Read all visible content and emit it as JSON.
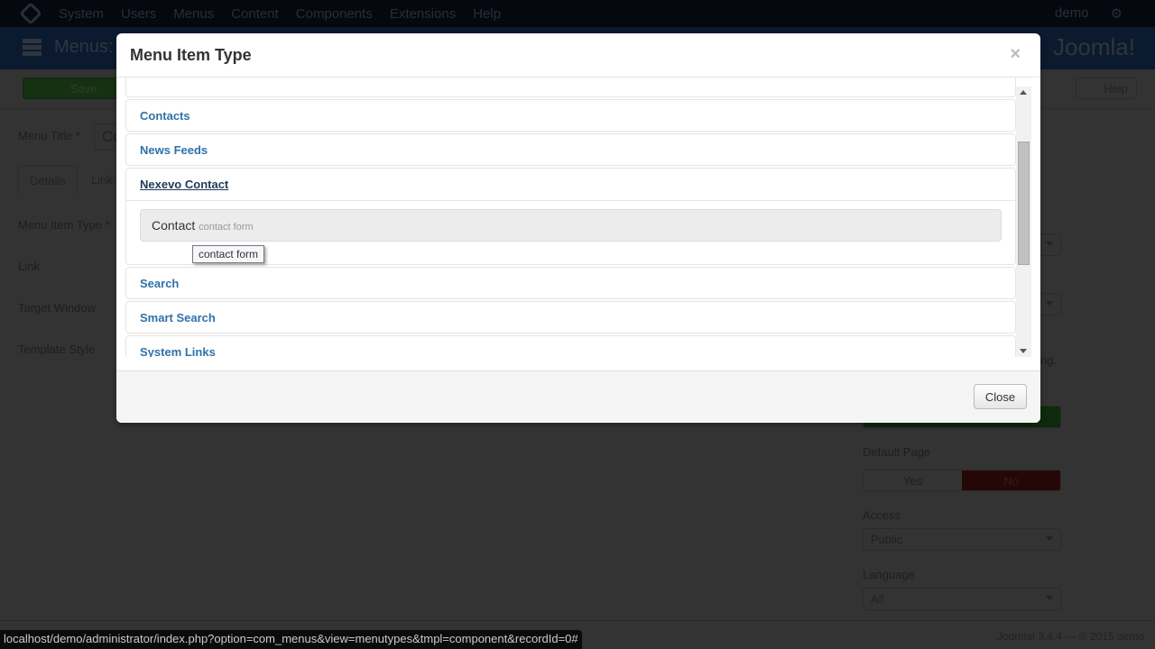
{
  "topnav": {
    "items": [
      "System",
      "Users",
      "Menus",
      "Content",
      "Components",
      "Extensions",
      "Help"
    ],
    "user": "demo"
  },
  "header": {
    "title": "Menus:",
    "brand": "Joomla!"
  },
  "toolbar": {
    "save": "Save",
    "help": "Help"
  },
  "form": {
    "menu_title_label": "Menu Title *",
    "menu_title_value": "Co",
    "tabs": [
      "Details",
      "Link"
    ],
    "fields": [
      "Menu Item Type *",
      "Link",
      "Target Window",
      "Template Style"
    ]
  },
  "side": {
    "partial_text": "ing.",
    "default_page_label": "Default Page",
    "yes": "Yes",
    "no": "No",
    "access_label": "Access",
    "access_value": "Public",
    "language_label": "Language",
    "language_value": "All"
  },
  "modal": {
    "title": "Menu Item Type",
    "close_label": "Close",
    "groups": [
      {
        "label": "Contacts"
      },
      {
        "label": "News Feeds"
      },
      {
        "label": "Nexevo Contact",
        "open": true,
        "items": [
          {
            "title": "Contact",
            "desc": "contact form"
          }
        ]
      },
      {
        "label": "Search"
      },
      {
        "label": "Smart Search"
      },
      {
        "label": "System Links"
      }
    ],
    "tooltip": "contact form"
  },
  "status_url": "localhost/demo/administrator/index.php?option=com_menus&view=menutypes&tmpl=component&recordId=0#",
  "footer": "Joomla! 3.4.4 — © 2015 demo"
}
